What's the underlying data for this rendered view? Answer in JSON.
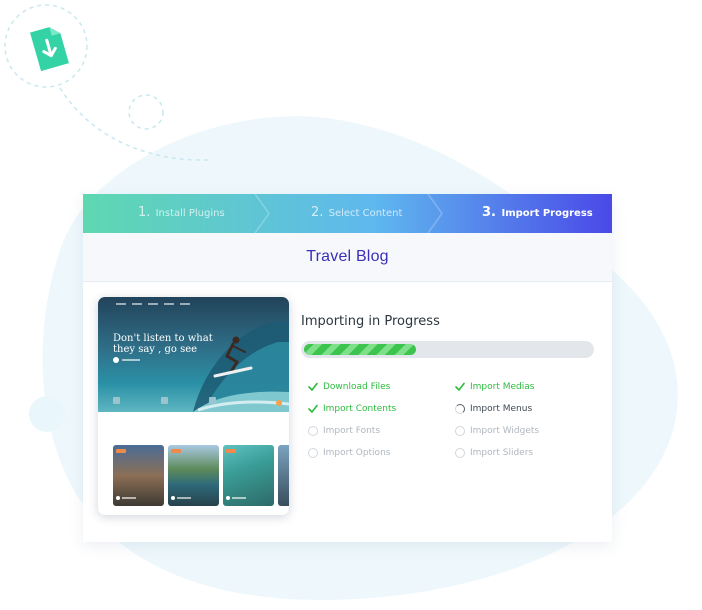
{
  "colors": {
    "accent": "#3a2fb8",
    "success": "#2dbb3f",
    "progress_fill": "#3cc44e",
    "steps_gradient_start": "#5fd8b0",
    "steps_gradient_end": "#4a49e8",
    "blob": "#eef8fc"
  },
  "icons": {
    "download_doc": "download-document-icon",
    "check": "check-icon",
    "spinner": "loading-spinner-icon",
    "pending": "empty-circle-icon"
  },
  "steps": [
    {
      "num": "1.",
      "label": "Install Plugins",
      "active": false
    },
    {
      "num": "2.",
      "label": "Select Content",
      "active": false
    },
    {
      "num": "3.",
      "label": "Import Progress",
      "active": true
    }
  ],
  "demo": {
    "title": "Travel Blog"
  },
  "preview": {
    "hero_heading": "Don't listen to what they say , go see"
  },
  "progress": {
    "title": "Importing in Progress",
    "fraction": 0.39
  },
  "tasks": {
    "download_files": "Download Files",
    "import_contents": "Import Contents",
    "import_fonts": "Import Fonts",
    "import_options": "Import Options",
    "import_medias": "Import Medias",
    "import_menus": "Import Menus",
    "import_widgets": "Import Widgets",
    "import_sliders": "Import Sliders"
  }
}
